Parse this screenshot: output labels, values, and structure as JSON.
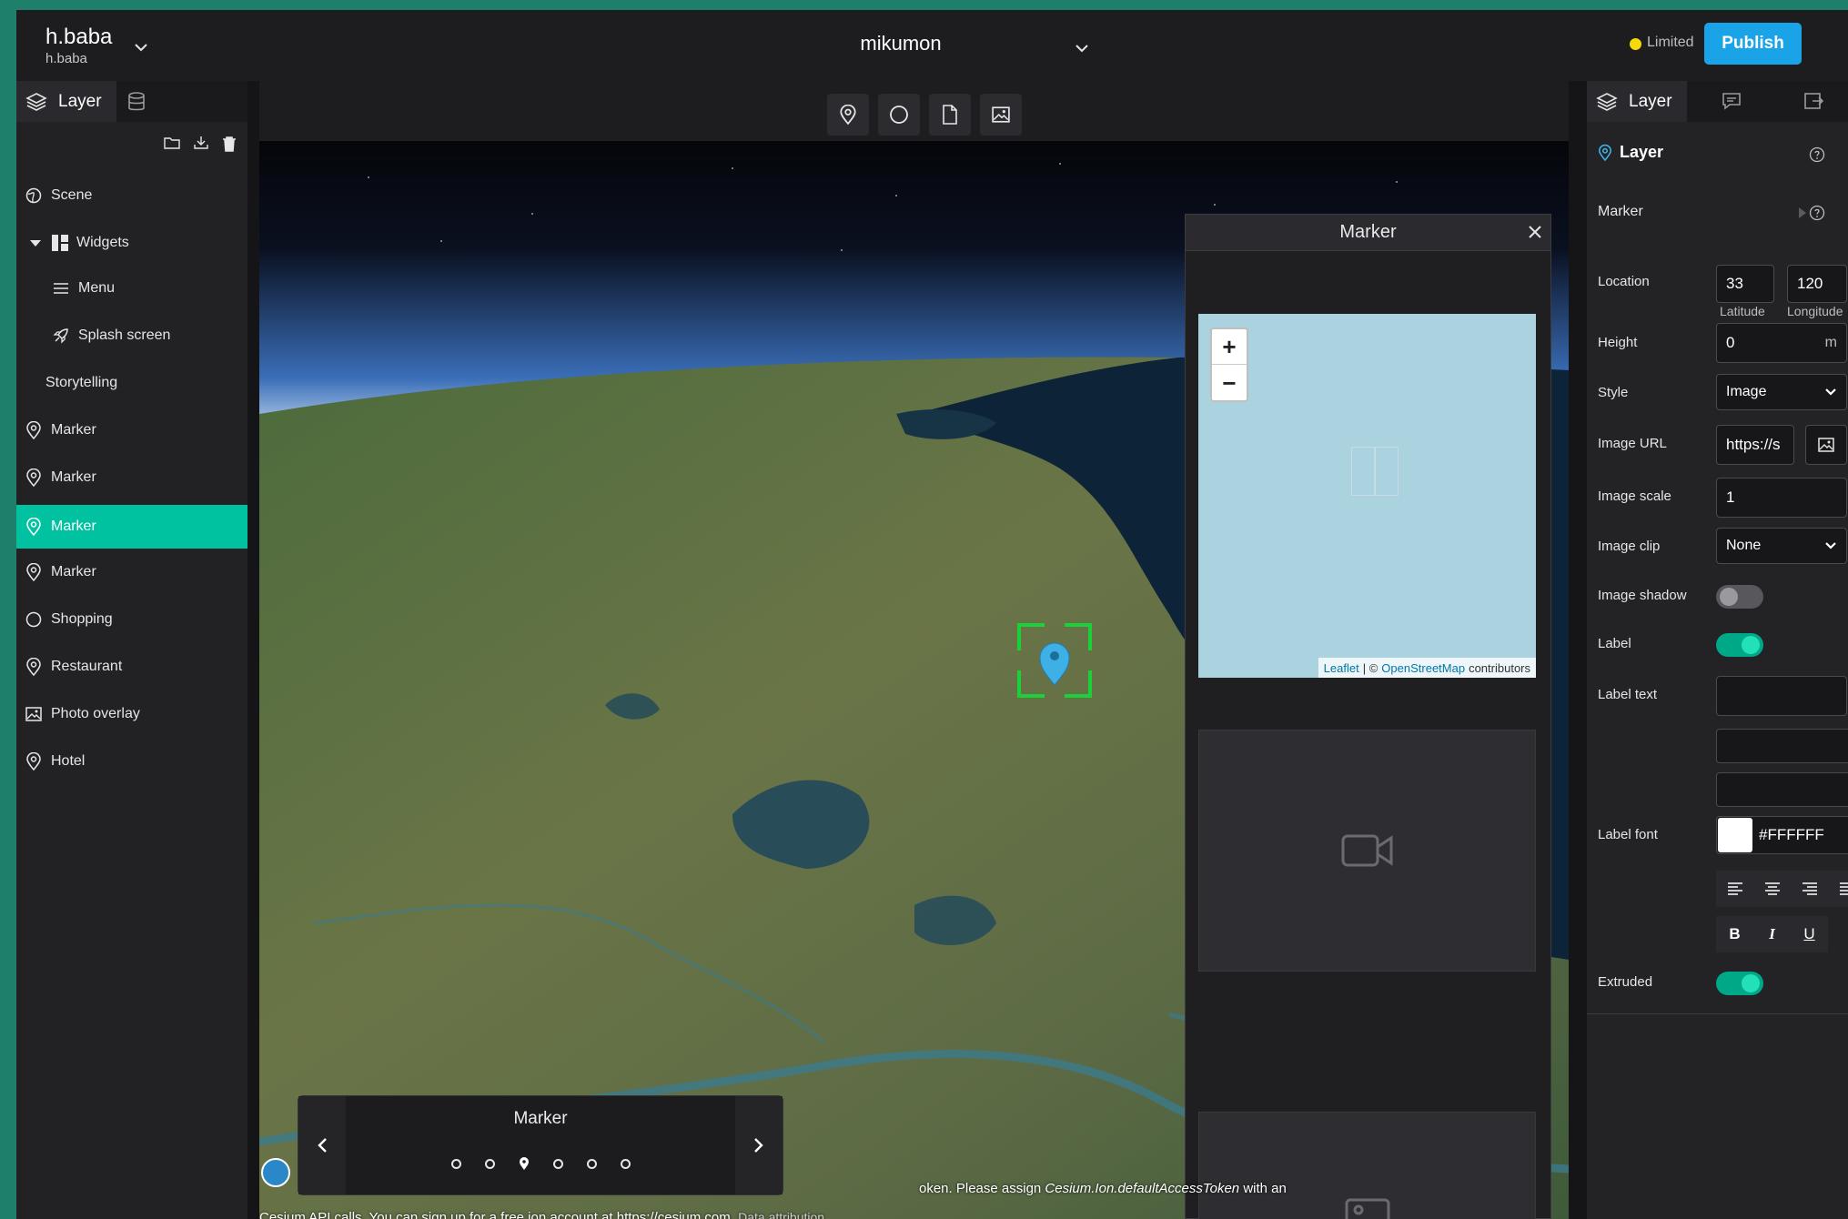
{
  "header": {
    "workspace_name": "h.baba",
    "workspace_sub": "h.baba",
    "project_title": "mikumon",
    "status": "Limited",
    "publish_label": "Publish",
    "accent": "#1ba3e8",
    "status_color": "#f5d90a"
  },
  "left_panel": {
    "tab_layer": "Layer",
    "items": [
      {
        "label": "Scene",
        "icon": "globe-icon"
      },
      {
        "label": "Widgets",
        "icon": "widgets-icon"
      },
      {
        "label": "Menu",
        "icon": "menu-icon"
      },
      {
        "label": "Splash screen",
        "icon": "rocket-icon"
      },
      {
        "label": "Storytelling",
        "icon": ""
      },
      {
        "label": "Marker",
        "icon": "pin-icon"
      },
      {
        "label": "Marker",
        "icon": "pin-icon"
      },
      {
        "label": "Marker",
        "icon": "pin-icon",
        "selected": true
      },
      {
        "label": "Marker",
        "icon": "pin-icon"
      },
      {
        "label": "Shopping",
        "icon": "circle-icon"
      },
      {
        "label": "Restaurant",
        "icon": "pin-icon"
      },
      {
        "label": "Photo overlay",
        "icon": "image-icon"
      },
      {
        "label": "Hotel",
        "icon": "pin-icon"
      }
    ],
    "selected_color": "#00c2a0"
  },
  "marker_panel": {
    "title": "Marker",
    "zoom_in": "+",
    "zoom_out": "−",
    "attr_leaflet": "Leaflet",
    "attr_sep": "| ©",
    "attr_osm": "OpenStreetMap",
    "attr_contrib": "contributors"
  },
  "story": {
    "title": "Marker"
  },
  "credits": {
    "line1_pre": "...",
    "line1_token_pre": "oken. Please assign ",
    "line1_token": "Cesium.Ion.defaultAccessToken",
    "line1_post": " with an",
    "line2_pre": "Cesium API calls. You can sign up for a free ion account at ",
    "line2_link": "https://cesium.com",
    "line2_dot": ".",
    "line2_attr": "Data attribution"
  },
  "right_panel": {
    "tab_layer": "Layer",
    "section_title": "Layer",
    "marker_label": "Marker",
    "fields": {
      "location_label": "Location",
      "latitude_value": "33",
      "longitude_value": "120",
      "latitude_sub": "Latitude",
      "longitude_sub": "Longitude",
      "height_label": "Height",
      "height_value": "0",
      "height_unit": "m",
      "style_label": "Style",
      "style_value": "Image",
      "image_url_label": "Image URL",
      "image_url_value": "https://s",
      "image_scale_label": "Image scale",
      "image_scale_value": "1",
      "image_clip_label": "Image clip",
      "image_clip_value": "None",
      "image_shadow_label": "Image shadow",
      "image_shadow_on": false,
      "label_label": "Label",
      "label_on": true,
      "label_text_label": "Label text",
      "label_text_value": "",
      "label_font_label": "Label font",
      "label_font_color": "#FFFFFF",
      "bold": "B",
      "italic": "I",
      "underline": "U",
      "extruded_label": "Extruded",
      "extruded_on": true
    }
  }
}
